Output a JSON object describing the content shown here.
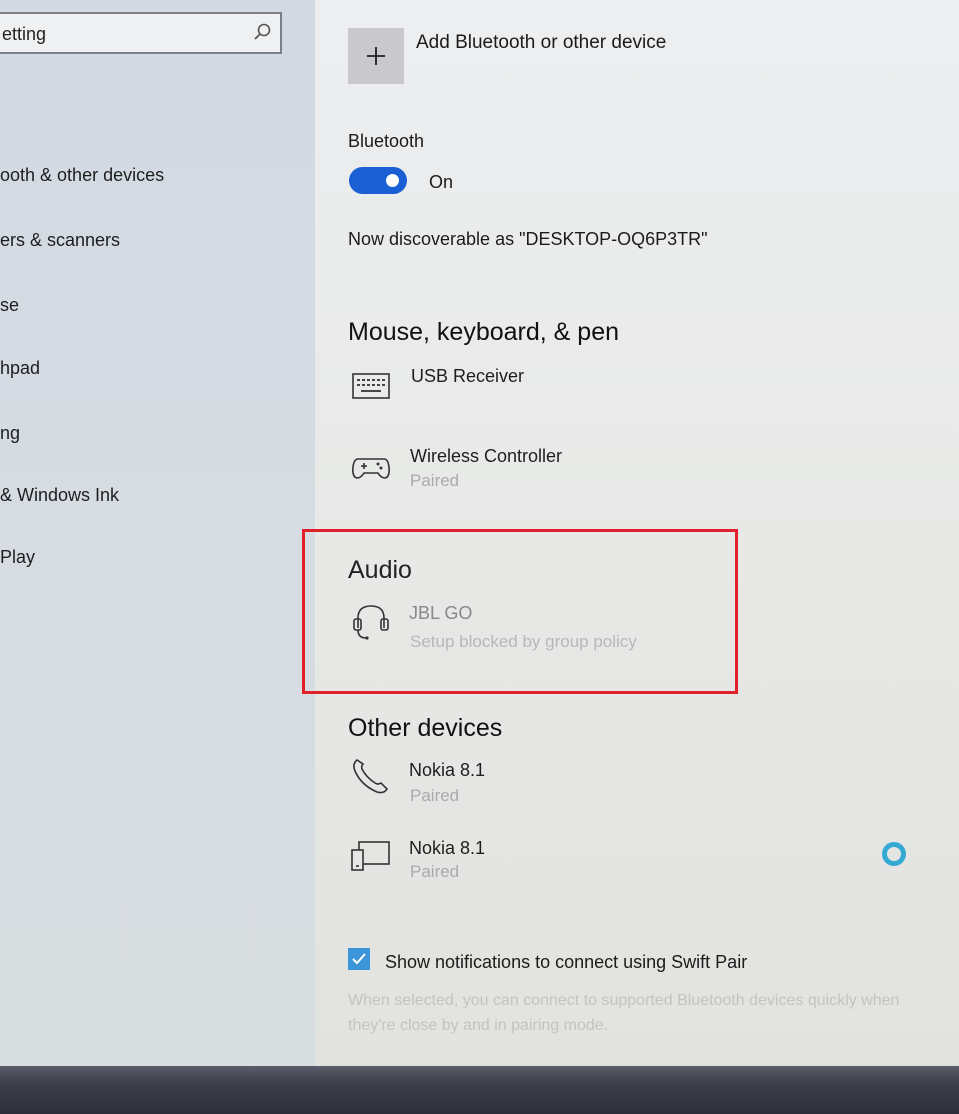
{
  "sidebar": {
    "search": {
      "value": "etting"
    },
    "items": [
      {
        "label": "ooth & other devices"
      },
      {
        "label": "ers & scanners"
      },
      {
        "label": "se"
      },
      {
        "label": "hpad"
      },
      {
        "label": "ng"
      },
      {
        "label": "& Windows Ink"
      },
      {
        "label": "Play"
      }
    ]
  },
  "main": {
    "add_device": {
      "label": "Add Bluetooth or other device",
      "icon": "plus-icon"
    },
    "bluetooth": {
      "heading": "Bluetooth",
      "toggle_state": "On",
      "toggle_color": "#1a5fd4",
      "discoverable_text": "Now discoverable as \"DESKTOP-OQ6P3TR\""
    },
    "sections": {
      "mouse": {
        "title": "Mouse, keyboard, & pen",
        "devices": [
          {
            "name": "USB Receiver",
            "status": "",
            "icon": "keyboard-icon"
          },
          {
            "name": "Wireless Controller",
            "status": "Paired",
            "icon": "gamepad-icon"
          }
        ]
      },
      "audio": {
        "title": "Audio",
        "devices": [
          {
            "name": "JBL GO",
            "status": "Setup blocked by group policy",
            "icon": "headset-icon"
          }
        ]
      },
      "other": {
        "title": "Other devices",
        "devices": [
          {
            "name": "Nokia 8.1",
            "status": "Paired",
            "icon": "phone-icon"
          },
          {
            "name": "Nokia 8.1",
            "status": "Paired",
            "icon": "device-icon"
          }
        ]
      }
    },
    "swift_pair": {
      "checked": true,
      "label": "Show notifications to connect using Swift Pair",
      "description": "When selected, you can connect to supported Bluetooth devices quickly when they're close by and in pairing mode."
    }
  },
  "annotation": {
    "highlight_color": "#e0202b"
  }
}
